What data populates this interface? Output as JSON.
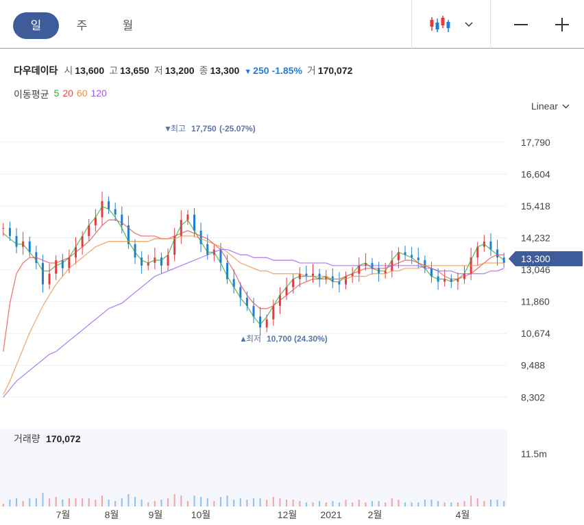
{
  "toolbar": {
    "tabs": [
      {
        "label": "일",
        "active": true
      },
      {
        "label": "주",
        "active": false
      },
      {
        "label": "월",
        "active": false
      }
    ],
    "chart_type_icon": "candlestick-icon",
    "dropdown_icon": "chevron-down-icon",
    "zoom_out_icon": "minus-icon",
    "zoom_in_icon": "plus-icon"
  },
  "quote": {
    "name": "다우데이타",
    "open_label": "시",
    "open": "13,600",
    "high_label": "고",
    "high": "13,650",
    "low_label": "저",
    "low": "13,200",
    "close_label": "종",
    "close": "13,300",
    "change": "250",
    "change_pct": "-1.85%",
    "volume_label": "거",
    "volume": "170,072"
  },
  "moving_average": {
    "label": "이동평균",
    "periods": [
      {
        "label": "5",
        "color": "#2ea82e"
      },
      {
        "label": "20",
        "color": "#e84a4a"
      },
      {
        "label": "60",
        "color": "#f08c3a"
      },
      {
        "label": "120",
        "color": "#9b59ea"
      }
    ]
  },
  "scale_selector": {
    "label": "Linear"
  },
  "colors": {
    "up": "#e5393f",
    "down": "#1e7ed6",
    "accent": "#3e5b9a",
    "grid": "#efefef",
    "volume_bg": "#f4f6fb"
  },
  "chart_data": {
    "type": "candlestick",
    "y_axis": {
      "ticks": [
        "17,790",
        "16,604",
        "15,418",
        "14,232",
        "13,046",
        "11,860",
        "10,674",
        "9,488",
        "8,302"
      ],
      "range": [
        7800,
        18500
      ]
    },
    "x_axis": {
      "ticks": [
        "7월",
        "8월",
        "9월",
        "10월",
        "12월",
        "2021",
        "2월",
        "4월"
      ]
    },
    "current_price": "13,300",
    "annotations": {
      "high": {
        "label": "최고",
        "value": "17,750",
        "pct": "(-25.07%)"
      },
      "low": {
        "label": "최저",
        "value": "10,700",
        "pct": "(24.30%)"
      }
    },
    "close_trend": [
      14600,
      14300,
      13900,
      14100,
      13700,
      13300,
      12500,
      12900,
      13400,
      13100,
      13500,
      13900,
      14300,
      14700,
      15000,
      15600,
      15300,
      15100,
      14700,
      14000,
      13500,
      13200,
      13300,
      13500,
      13200,
      13600,
      14300,
      14900,
      15100,
      14500,
      14000,
      13600,
      13800,
      13300,
      12700,
      12400,
      12000,
      11700,
      11300,
      10900,
      11200,
      11700,
      12100,
      12400,
      12700,
      12900,
      12800,
      12900,
      12700,
      12800,
      12600,
      12500,
      12800,
      12900,
      13200,
      13300,
      13100,
      12900,
      13000,
      13400,
      13700,
      13600,
      13500,
      13400,
      13100,
      12800,
      12600,
      12700,
      12600,
      12700,
      12900,
      13500,
      13900,
      14100,
      13800,
      13500,
      13300
    ],
    "volume": {
      "label": "거래량",
      "value": "170,072",
      "axis_tick": "11.5m"
    },
    "moving_averages": [
      {
        "name": "5",
        "values": [
          14400,
          14200,
          14000,
          14000,
          13700,
          13400,
          13000,
          13000,
          13200,
          13300,
          13500,
          13900,
          14300,
          14700,
          15000,
          15400,
          15300,
          15000,
          14600,
          14100,
          13700,
          13400,
          13300,
          13400,
          13400,
          13600,
          14200,
          14700,
          14900,
          14500,
          14100,
          13700,
          13700,
          13300,
          12800,
          12400,
          12000,
          11700,
          11300,
          11000,
          11300,
          11700,
          12100,
          12400,
          12700,
          12800,
          12800,
          12800,
          12700,
          12800,
          12600,
          12600,
          12800,
          12900,
          13200,
          13300,
          13100,
          13000,
          13000,
          13400,
          13700,
          13600,
          13500,
          13300,
          13100,
          12800,
          12700,
          12700,
          12600,
          12700,
          12900,
          13400,
          13900,
          14000,
          13800,
          13600,
          13400
        ]
      },
      {
        "name": "20",
        "values": [
          10000,
          11800,
          12900,
          13300,
          13500,
          13500,
          13400,
          13300,
          13300,
          13400,
          13500,
          13700,
          13900,
          14100,
          14400,
          14700,
          14900,
          14900,
          14800,
          14600,
          14400,
          14300,
          14300,
          14300,
          14200,
          14200,
          14300,
          14400,
          14500,
          14400,
          14300,
          14200,
          14000,
          13800,
          13400,
          13000,
          12500,
          12100,
          11800,
          11600,
          11600,
          11700,
          11900,
          12100,
          12300,
          12500,
          12600,
          12700,
          12700,
          12700,
          12700,
          12700,
          12800,
          12900,
          13000,
          13100,
          13100,
          13100,
          13100,
          13200,
          13300,
          13400,
          13400,
          13300,
          13200,
          13100,
          13000,
          12800,
          12700,
          12700,
          12800,
          12900,
          13100,
          13300,
          13500,
          13600,
          13600
        ]
      },
      {
        "name": "60",
        "values": [
          8400,
          8900,
          9500,
          10100,
          10700,
          11200,
          11700,
          12100,
          12500,
          12800,
          13100,
          13300,
          13500,
          13700,
          13900,
          14000,
          14100,
          14100,
          14100,
          14100,
          14100,
          14100,
          14100,
          14200,
          14200,
          14200,
          14200,
          14300,
          14300,
          14300,
          14200,
          14100,
          14000,
          13900,
          13700,
          13500,
          13300,
          13200,
          13100,
          13000,
          13000,
          12900,
          12900,
          12900,
          12900,
          12900,
          12800,
          12800,
          12800,
          12800,
          12700,
          12700,
          12700,
          12800,
          12800,
          12800,
          12900,
          12900,
          12900,
          13000,
          13000,
          13100,
          13100,
          13100,
          13200,
          13200,
          13200,
          13200,
          13200,
          13200,
          13200,
          13200,
          13200,
          13300,
          13300,
          13300,
          13300
        ]
      },
      {
        "name": "120",
        "values": [
          8300,
          8600,
          8900,
          9100,
          9300,
          9500,
          9700,
          9900,
          10000,
          10200,
          10400,
          10600,
          10800,
          11000,
          11200,
          11400,
          11600,
          11700,
          11800,
          12000,
          12200,
          12400,
          12600,
          12800,
          12900,
          13000,
          13100,
          13200,
          13300,
          13400,
          13500,
          13600,
          13700,
          13800,
          13800,
          13700,
          13600,
          13600,
          13500,
          13500,
          13500,
          13400,
          13400,
          13400,
          13400,
          13300,
          13300,
          13300,
          13300,
          13300,
          13200,
          13200,
          13200,
          13200,
          13200,
          13200,
          13200,
          13200,
          13200,
          13200,
          13200,
          13200,
          13200,
          13200,
          13100,
          13100,
          13000,
          13000,
          13000,
          12900,
          12900,
          12900,
          12900,
          12900,
          13000,
          13000,
          13100
        ]
      }
    ]
  }
}
